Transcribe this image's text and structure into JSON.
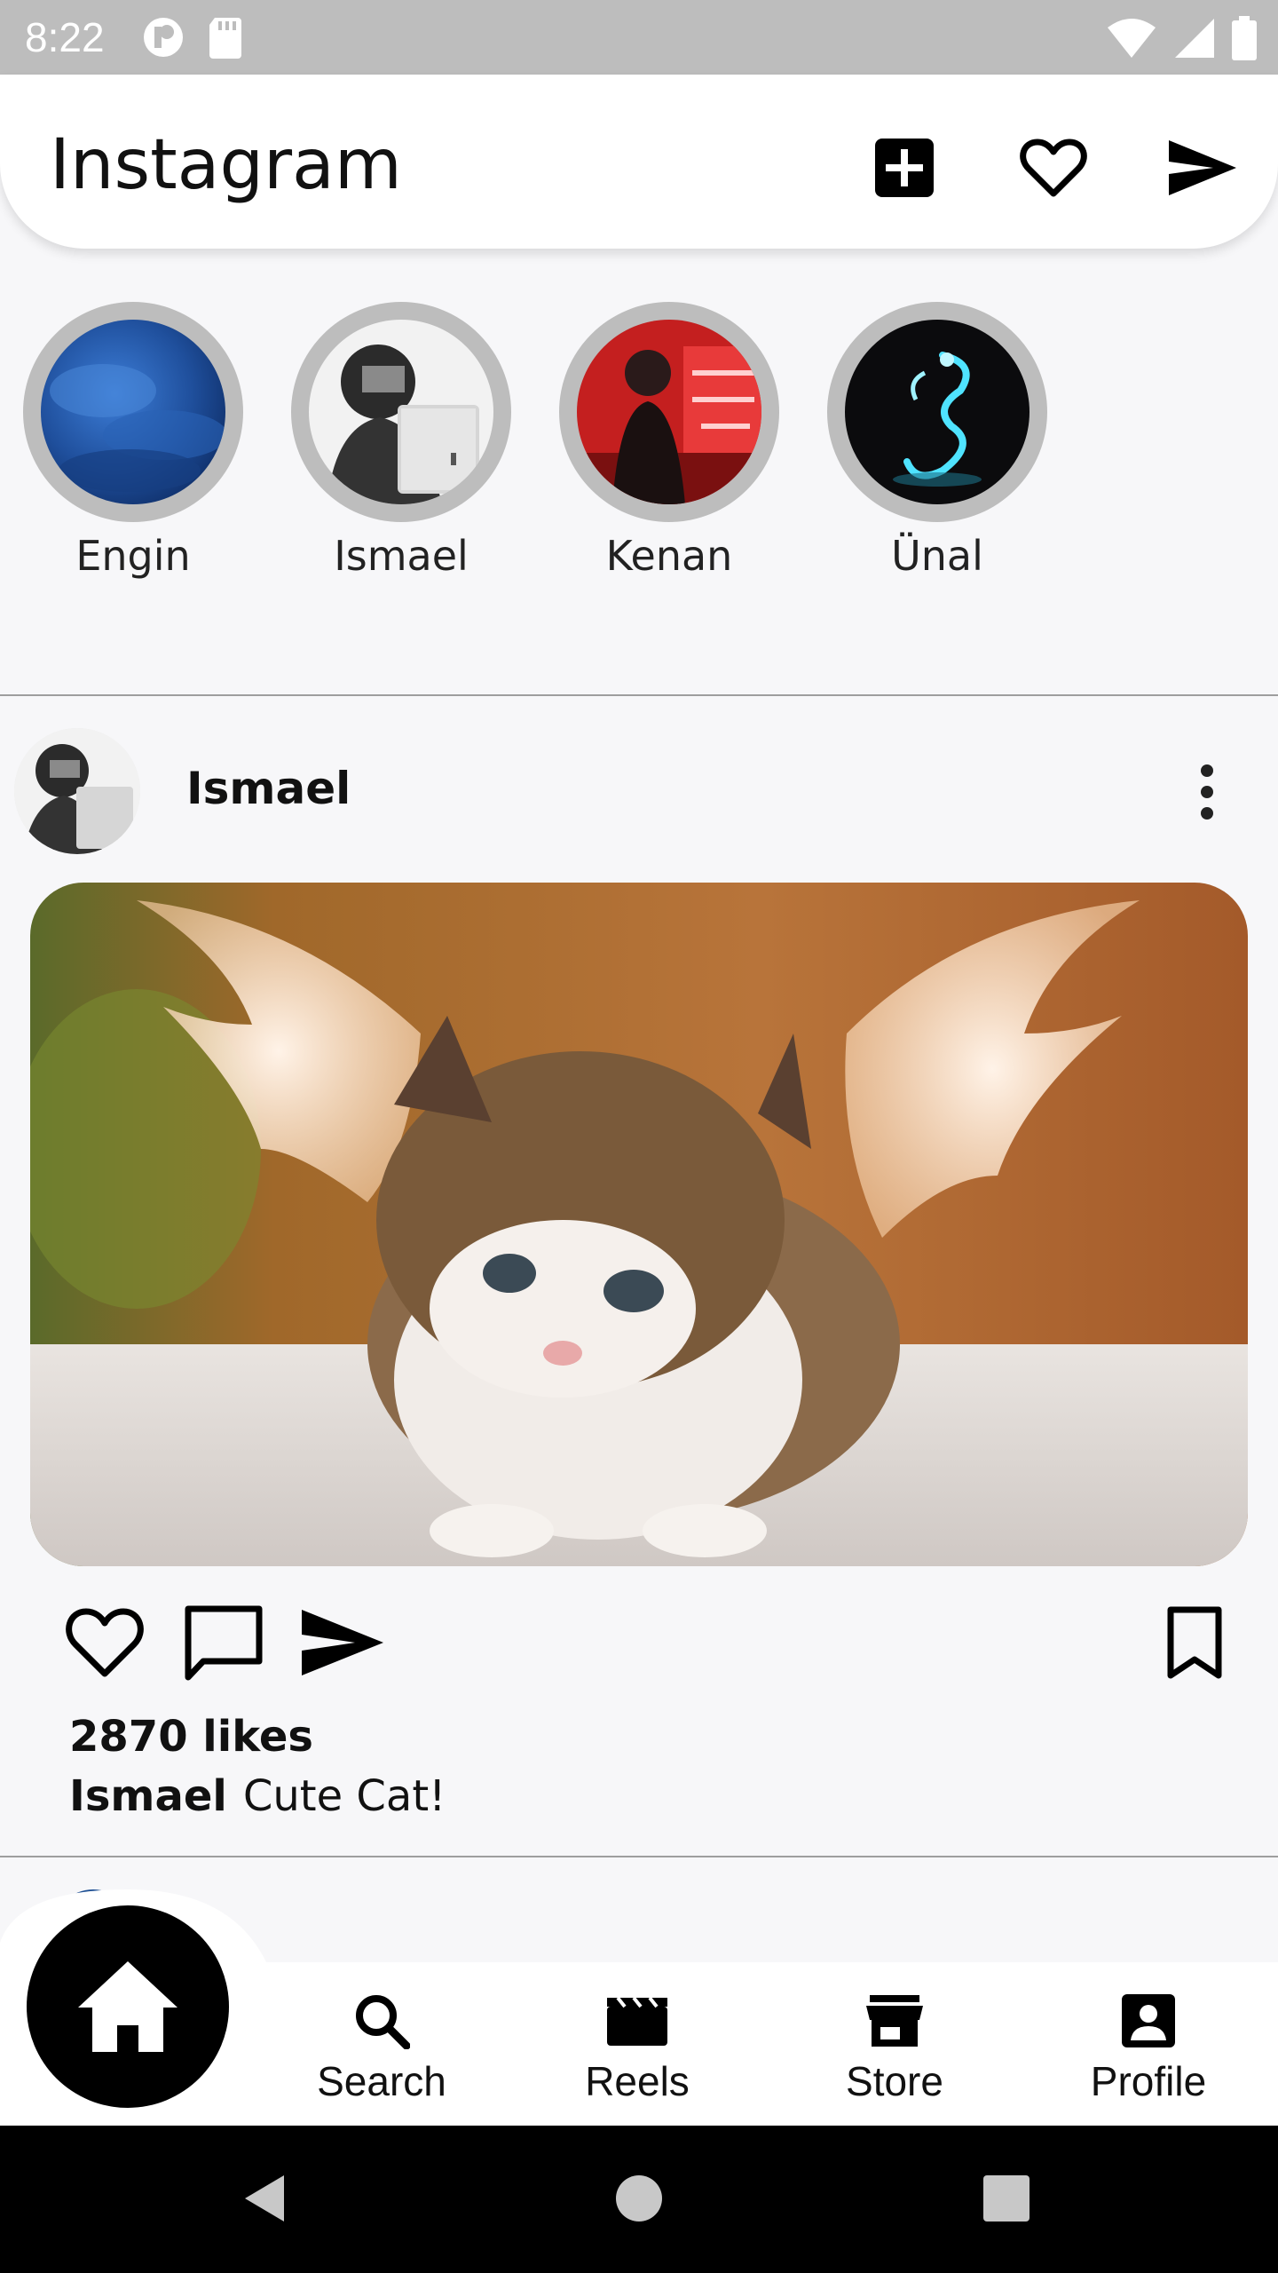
{
  "status_bar": {
    "time": "8:22",
    "left_icons": [
      "app-notification-icon",
      "sd-card-icon"
    ],
    "right_icons": [
      "wifi-icon",
      "signal-icon",
      "battery-icon"
    ]
  },
  "app_bar": {
    "title": "Instagram",
    "actions": [
      "add-post-icon",
      "heart-icon",
      "send-icon"
    ]
  },
  "stories": [
    {
      "name": "Engin"
    },
    {
      "name": "Ismael"
    },
    {
      "name": "Kenan"
    },
    {
      "name": "Ünal"
    }
  ],
  "post": {
    "username": "Ismael",
    "likes": "2870 likes",
    "caption_user": "Ismael",
    "caption_text": "Cute Cat!"
  },
  "bottom_nav": {
    "items": [
      {
        "label": "Search",
        "icon": "search-icon"
      },
      {
        "label": "Reels",
        "icon": "reels-icon"
      },
      {
        "label": "Store",
        "icon": "store-icon"
      },
      {
        "label": "Profile",
        "icon": "profile-icon"
      }
    ],
    "active": "home"
  },
  "colors": {
    "status_bar": "#bdbdbd",
    "story_ring": "#bdbdbd",
    "background": "#f7f7f9",
    "home_button": "#000000"
  }
}
